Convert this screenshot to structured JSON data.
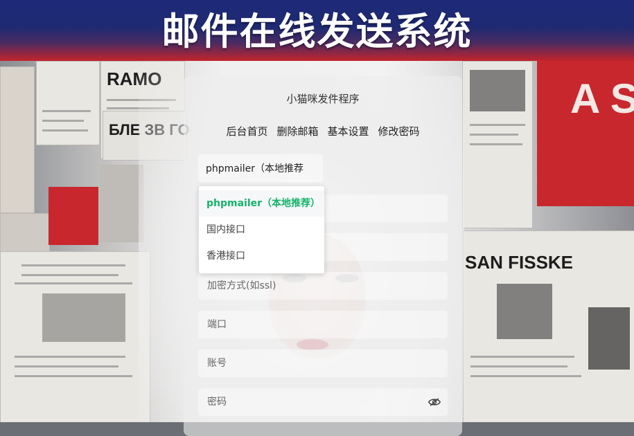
{
  "banner": {
    "title": "邮件在线发送系统"
  },
  "background": {
    "poster_texts": [
      "RAMO",
      "БЛЕ ЗВ ГО",
      "A S",
      "SAN FISSKE"
    ]
  },
  "card": {
    "title": "小猫咪发件程序",
    "nav": [
      "后台首页",
      "删除邮箱",
      "基本设置",
      "修改密码"
    ],
    "interface_select": {
      "value": "phpmailer（本地推荐"
    },
    "fields": {
      "encryption_placeholder": "加密方式(如ssl)",
      "port_placeholder": "端口",
      "account_placeholder": "账号",
      "password_placeholder": "密码"
    },
    "password_toggle_icon": "eye-icon"
  },
  "dropdown": {
    "options": [
      "phpmailer（本地推荐）",
      "国内接口",
      "香港接口"
    ],
    "selected_index": 0,
    "selected_color": "#16b36a"
  },
  "colors": {
    "banner_top": "#1e2a78",
    "banner_bottom": "#c2242c",
    "accent_green": "#16b36a"
  }
}
